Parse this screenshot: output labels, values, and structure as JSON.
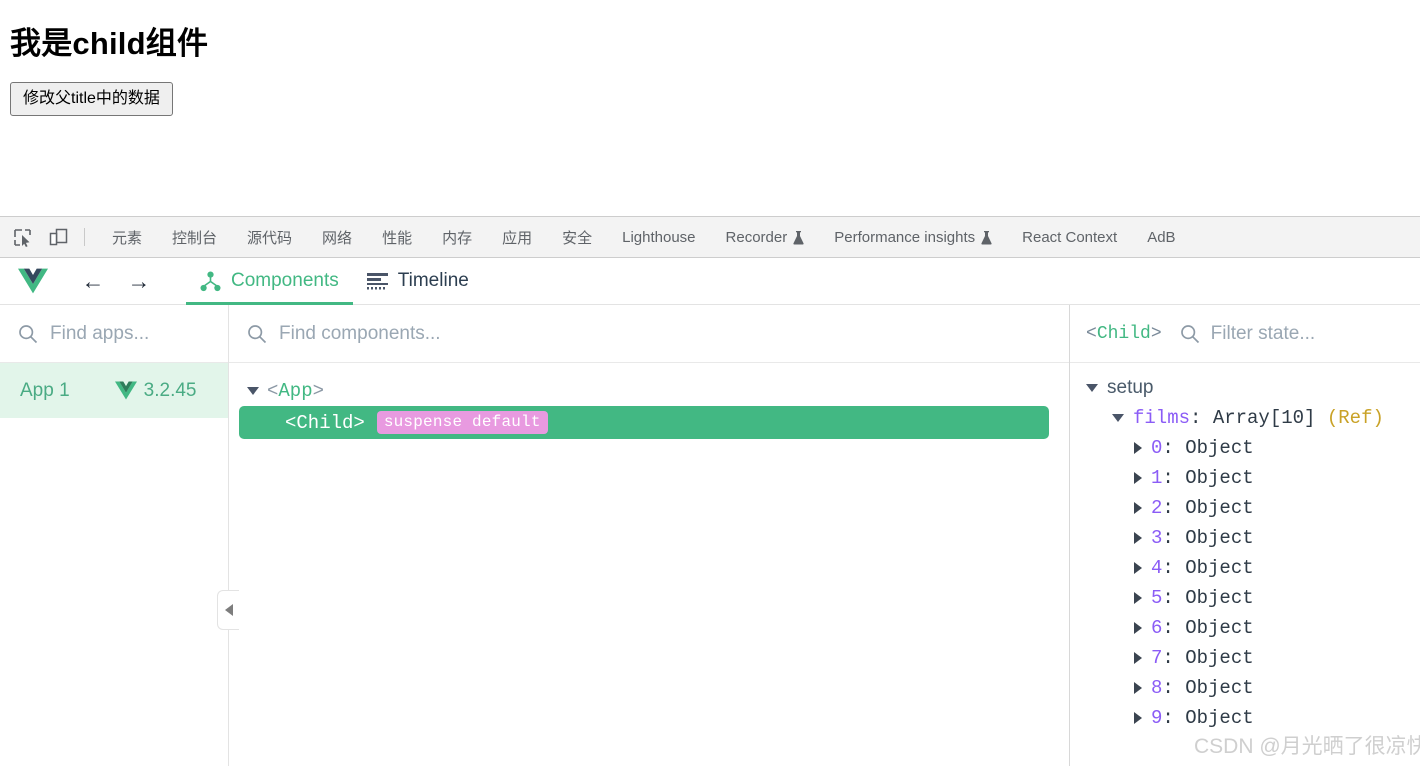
{
  "page": {
    "heading": "我是child组件",
    "button_label": "修改父title中的数据"
  },
  "devtools_tabs": {
    "inspect_icon": "inspect-element-icon",
    "device_icon": "device-toolbar-icon",
    "items": [
      {
        "label": "元素",
        "flask": false
      },
      {
        "label": "控制台",
        "flask": false
      },
      {
        "label": "源代码",
        "flask": false
      },
      {
        "label": "网络",
        "flask": false
      },
      {
        "label": "性能",
        "flask": false
      },
      {
        "label": "内存",
        "flask": false
      },
      {
        "label": "应用",
        "flask": false
      },
      {
        "label": "安全",
        "flask": false
      },
      {
        "label": "Lighthouse",
        "flask": false
      },
      {
        "label": "Recorder",
        "flask": true
      },
      {
        "label": "Performance insights",
        "flask": true
      },
      {
        "label": "React Context",
        "flask": false
      },
      {
        "label": "AdB",
        "flask": false
      }
    ]
  },
  "vue_toolbar": {
    "logo": "vue-logo",
    "back_label": "←",
    "forward_label": "→",
    "tabs": [
      {
        "label": "Components",
        "active": true
      },
      {
        "label": "Timeline",
        "active": false
      }
    ]
  },
  "apps_panel": {
    "search_placeholder": "Find apps...",
    "apps": [
      {
        "name": "App 1",
        "version": "3.2.45"
      }
    ]
  },
  "tree_panel": {
    "search_placeholder": "Find components...",
    "nodes": [
      {
        "open": "<",
        "name": "App",
        "close": ">",
        "selected": false,
        "badge": null
      },
      {
        "open": "<",
        "name": "Child",
        "close": ">",
        "selected": true,
        "badge": "suspense default"
      }
    ]
  },
  "state_panel": {
    "component_open": "<",
    "component_name": "Child",
    "component_close": ">",
    "filter_placeholder": "Filter state...",
    "groups": [
      {
        "label": "setup",
        "entries": [
          {
            "key": "films",
            "colon": ":",
            "type": "Array[10]",
            "ref": "(Ref)",
            "items": [
              {
                "index": "0",
                "colon": ":",
                "value": "Object"
              },
              {
                "index": "1",
                "colon": ":",
                "value": "Object"
              },
              {
                "index": "2",
                "colon": ":",
                "value": "Object"
              },
              {
                "index": "3",
                "colon": ":",
                "value": "Object"
              },
              {
                "index": "4",
                "colon": ":",
                "value": "Object"
              },
              {
                "index": "5",
                "colon": ":",
                "value": "Object"
              },
              {
                "index": "6",
                "colon": ":",
                "value": "Object"
              },
              {
                "index": "7",
                "colon": ":",
                "value": "Object"
              },
              {
                "index": "8",
                "colon": ":",
                "value": "Object"
              },
              {
                "index": "9",
                "colon": ":",
                "value": "Object"
              }
            ]
          }
        ]
      }
    ]
  },
  "watermark": {
    "text": "CSDN @月光晒了很凉快"
  },
  "colors": {
    "vue_green": "#42b883",
    "badge_pink": "#e89ae0",
    "app_row_bg": "#e2f5ea",
    "tabbar_bg": "#f3f3f3"
  }
}
